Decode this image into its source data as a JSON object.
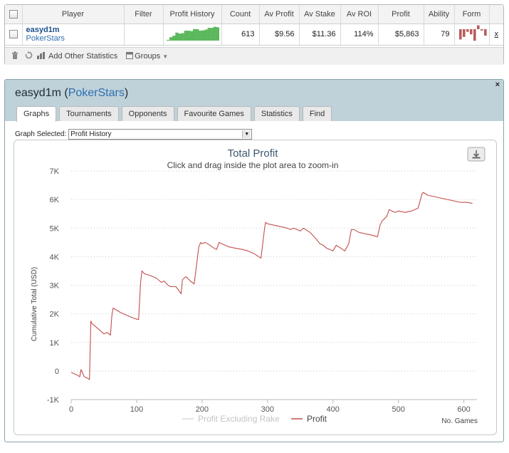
{
  "stats_table": {
    "headers": [
      "Player",
      "Filter",
      "Profit History",
      "Count",
      "Av Profit",
      "Av Stake",
      "Av ROI",
      "Profit",
      "Ability",
      "Form"
    ],
    "row": {
      "player_name": "easyd1m",
      "site": "PokerStars",
      "filter": "",
      "count": "613",
      "av_profit": "$9.56",
      "av_stake": "$11.36",
      "av_roi": "114%",
      "profit": "$5,863",
      "ability": "79",
      "remove": "x"
    },
    "sparkline_color": "#5cb85c",
    "form_bars": [
      -8,
      -6,
      -2,
      -4,
      -9,
      3,
      -1,
      -5
    ],
    "form_color": "#b85c5c",
    "toolbar": {
      "add_stats_label": "Add Other Statistics",
      "groups_label": "Groups"
    }
  },
  "panel": {
    "player_name": "easyd1m",
    "site": "PokerStars",
    "close": "×",
    "tabs": [
      "Graphs",
      "Tournaments",
      "Opponents",
      "Favourite Games",
      "Statistics",
      "Find"
    ],
    "active_tab": "Graphs",
    "graph_selected_label": "Graph Selected:",
    "graph_selected_value": "Profit History"
  },
  "chart_data": {
    "type": "line",
    "title": "Total Profit",
    "subtitle": "Click and drag inside the plot area to zoom-in",
    "ylabel": "Cumulative Total (USD)",
    "xlabel": "No. Games",
    "ylim": [
      -1000,
      7000
    ],
    "xlim": [
      0,
      620
    ],
    "y_ticks": [
      "-1K",
      "0",
      "1K",
      "2K",
      "3K",
      "4K",
      "5K",
      "6K",
      "7K"
    ],
    "y_tick_values": [
      -1000,
      0,
      1000,
      2000,
      3000,
      4000,
      5000,
      6000,
      7000
    ],
    "x_ticks": [
      0,
      100,
      200,
      300,
      400,
      500,
      600
    ],
    "grid": true,
    "legend": [
      "Profit Excluding Rake",
      "Profit"
    ],
    "legend_placement": "bottom-center",
    "series": [
      {
        "name": "Profit",
        "color": "#c0504d",
        "x": [
          0,
          5,
          10,
          13,
          15,
          18,
          20,
          22,
          25,
          28,
          30,
          32,
          35,
          40,
          45,
          50,
          55,
          60,
          62,
          64,
          68,
          75,
          85,
          95,
          103,
          106,
          108,
          112,
          120,
          130,
          138,
          142,
          148,
          152,
          160,
          165,
          168,
          170,
          175,
          178,
          182,
          188,
          195,
          198,
          200,
          205,
          212,
          218,
          222,
          226,
          230,
          240,
          250,
          262,
          270,
          275,
          280,
          290,
          295,
          297,
          300,
          310,
          320,
          330,
          335,
          340,
          350,
          355,
          365,
          375,
          380,
          385,
          390,
          400,
          405,
          415,
          418,
          424,
          428,
          432,
          436,
          440,
          450,
          460,
          468,
          472,
          475,
          482,
          486,
          490,
          495,
          500,
          510,
          520,
          530,
          536,
          538,
          545,
          555,
          565,
          575,
          585,
          595,
          605,
          613
        ],
        "y": [
          -50,
          -100,
          -150,
          -200,
          50,
          -100,
          -200,
          -220,
          -250,
          -300,
          1750,
          1650,
          1600,
          1500,
          1400,
          1300,
          1350,
          1250,
          1900,
          2200,
          2150,
          2050,
          1950,
          1850,
          1800,
          3100,
          3500,
          3400,
          3350,
          3250,
          3100,
          3150,
          3000,
          2950,
          2950,
          2800,
          2700,
          3200,
          3300,
          3250,
          3150,
          3050,
          4350,
          4500,
          4450,
          4500,
          4400,
          4300,
          4250,
          4500,
          4450,
          4350,
          4300,
          4250,
          4200,
          4150,
          4100,
          3950,
          4900,
          5200,
          5150,
          5100,
          5050,
          5000,
          4950,
          5000,
          4900,
          5000,
          4850,
          4600,
          4450,
          4400,
          4300,
          4200,
          4400,
          4250,
          4200,
          4450,
          4950,
          4950,
          4900,
          4850,
          4800,
          4750,
          4700,
          5100,
          5250,
          5400,
          5650,
          5600,
          5550,
          5600,
          5550,
          5600,
          5700,
          6200,
          6250,
          6150,
          6100,
          6050,
          6000,
          5950,
          5900,
          5900,
          5863
        ]
      },
      {
        "name": "Profit Excluding Rake",
        "color": "#d9d9d9",
        "x": [],
        "y": []
      }
    ]
  }
}
